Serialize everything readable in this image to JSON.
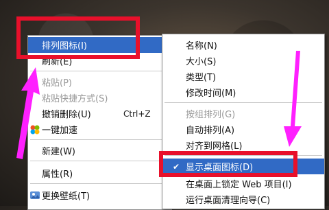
{
  "main_menu": {
    "items": [
      {
        "label": "排列图标(I)",
        "arrow": "▶",
        "highlighted": true
      },
      {
        "label": "刷新(E)"
      },
      {
        "label": "粘贴(P)",
        "disabled": true
      },
      {
        "label": "粘贴快捷方式(S)",
        "disabled": true
      },
      {
        "label": "撤销删除(U)",
        "shortcut": "Ctrl+Z"
      },
      {
        "label": "一键加速",
        "icon": "accelerate-icon"
      },
      {
        "label": "新建(W)",
        "arrow": "▶"
      },
      {
        "label": "属性(R)"
      },
      {
        "label": "更换壁纸(T)",
        "icon": "wallpaper-icon"
      }
    ]
  },
  "sub_menu": {
    "items": [
      {
        "label": "名称(N)"
      },
      {
        "label": "大小(S)"
      },
      {
        "label": "类型(T)"
      },
      {
        "label": "修改时间(M)"
      },
      {
        "label": "按组排列(G)",
        "disabled": true
      },
      {
        "label": "自动排列(A)"
      },
      {
        "label": "对齐到网格(L)"
      },
      {
        "label": "显示桌面图标(D)",
        "checked": true,
        "check": "✔",
        "highlighted": true
      },
      {
        "label": "在桌面上锁定 Web 项目(I)"
      },
      {
        "label": "运行桌面清理向导(C)"
      }
    ]
  },
  "annotations": {
    "box_color": "#e8102b",
    "arrow_color": "#ff20ff"
  }
}
